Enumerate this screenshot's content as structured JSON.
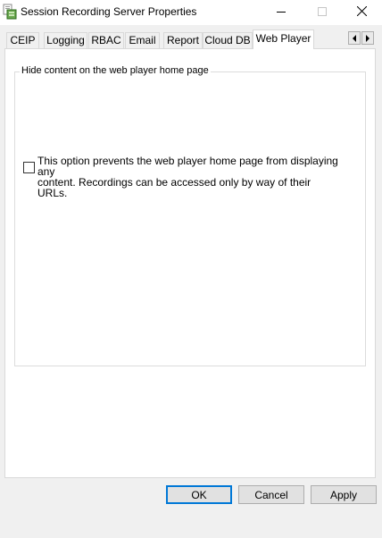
{
  "window": {
    "title": "Session Recording Server Properties",
    "icons": {
      "app": "session-recording-server-icon",
      "minimize": "minimize-icon",
      "maximize": "maximize-icon",
      "close": "close-icon"
    }
  },
  "tabs": [
    {
      "label": "CEIP",
      "active": false
    },
    {
      "label": "Logging",
      "active": false
    },
    {
      "label": "RBAC",
      "active": false
    },
    {
      "label": "Email",
      "active": false
    },
    {
      "label": "Report",
      "active": false
    },
    {
      "label": "Cloud DB",
      "active": false
    },
    {
      "label": "Web Player",
      "active": true
    }
  ],
  "tab_scroll": {
    "left_icon": "chevron-left-icon",
    "right_icon": "chevron-right-icon"
  },
  "web_player": {
    "group_title": "Hide content on the web player home page",
    "checkbox_label_line1": "This option prevents the web player home page from displaying any",
    "checkbox_label_line2": "content. Recordings can be accessed only by way of their URLs.",
    "checked": false
  },
  "buttons": {
    "ok": "OK",
    "cancel": "Cancel",
    "apply": "Apply"
  },
  "colors": {
    "default_button_border": "#0078d7",
    "dialog_bg": "#f0f0f0",
    "page_bg": "#ffffff"
  }
}
